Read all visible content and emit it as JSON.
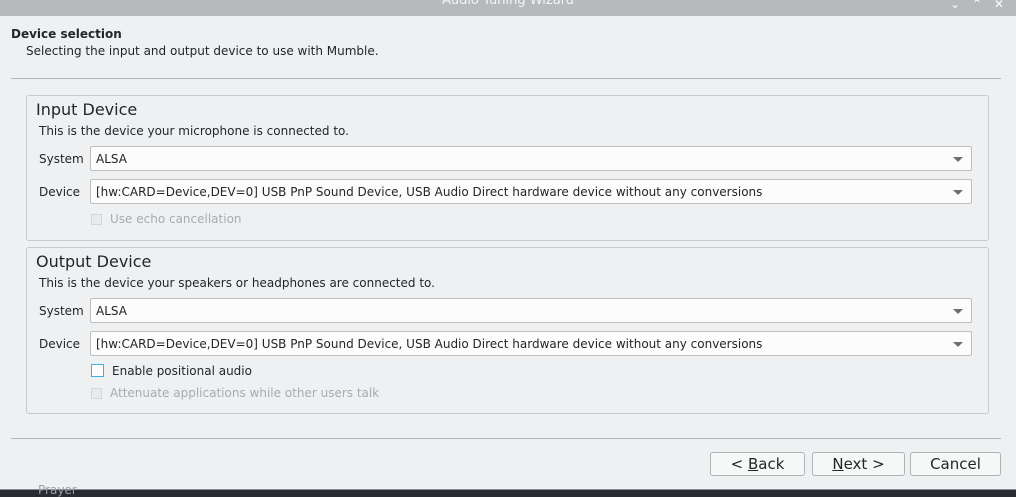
{
  "window": {
    "title": "Audio Tuning Wizard",
    "controls": {
      "minimize": "⌄",
      "maximize": "⌃",
      "close": "✕"
    }
  },
  "header": {
    "title": "Device selection",
    "subtitle": "Selecting the input and output device to use with Mumble."
  },
  "input": {
    "title": "Input Device",
    "description": "This is the device your microphone is connected to.",
    "system_label": "System",
    "system_value": "ALSA",
    "device_label": "Device",
    "device_value": "[hw:CARD=Device,DEV=0] USB PnP Sound Device, USB Audio Direct hardware device without any conversions",
    "echo_label": "Use echo cancellation",
    "echo_checked": false,
    "echo_enabled": false
  },
  "output": {
    "title": "Output Device",
    "description": "This is the device your speakers or headphones are connected to.",
    "system_label": "System",
    "system_value": "ALSA",
    "device_label": "Device",
    "device_value": "[hw:CARD=Device,DEV=0] USB PnP Sound Device, USB Audio Direct hardware device without any conversions",
    "positional_label": "Enable positional audio",
    "positional_checked": false,
    "attenuate_label": "Attenuate applications while other users talk",
    "attenuate_checked": false,
    "attenuate_enabled": false
  },
  "buttons": {
    "back_prefix": "< ",
    "back_mnemonic": "B",
    "back_rest": "ack",
    "next_mnemonic": "N",
    "next_rest": "ext >",
    "cancel": "Cancel"
  },
  "background": {
    "partial_text": "Prayer"
  },
  "colors": {
    "focus_accent": "#3daee9",
    "window_bg": "#eff0f1"
  }
}
